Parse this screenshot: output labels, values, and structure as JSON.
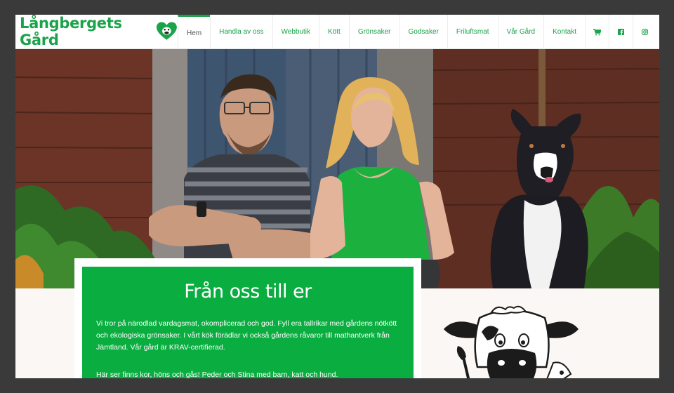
{
  "header": {
    "logo_text": "Långbergets Gård",
    "nav": [
      {
        "label": "Hem",
        "active": true
      },
      {
        "label": "Handla av oss"
      },
      {
        "label": "Webbutik"
      },
      {
        "label": "Kött"
      },
      {
        "label": "Grönsaker"
      },
      {
        "label": "Godsaker"
      },
      {
        "label": "Friluftsmat"
      },
      {
        "label": "Vår Gård"
      },
      {
        "label": "Kontakt"
      }
    ],
    "icons": [
      "cart-icon",
      "facebook-icon",
      "instagram-icon"
    ]
  },
  "intro": {
    "title": "Från oss till er",
    "paragraph1": "Vi tror på närodlad vardagsmat, okomplicerad och god. Fyll era tallrikar med gårdens nötkött och ekologiska grönsaker. I vårt kök förädlar vi också gårdens råvaror till mathantverk från Jämtland. Vår gård är KRAV-certifierad.",
    "paragraph2": "Här ser finns kor, höns och gås! Peder och Stina med barn, katt och hund."
  },
  "colors": {
    "brand_green": "#1aa34a",
    "box_green": "#0aad3f"
  }
}
